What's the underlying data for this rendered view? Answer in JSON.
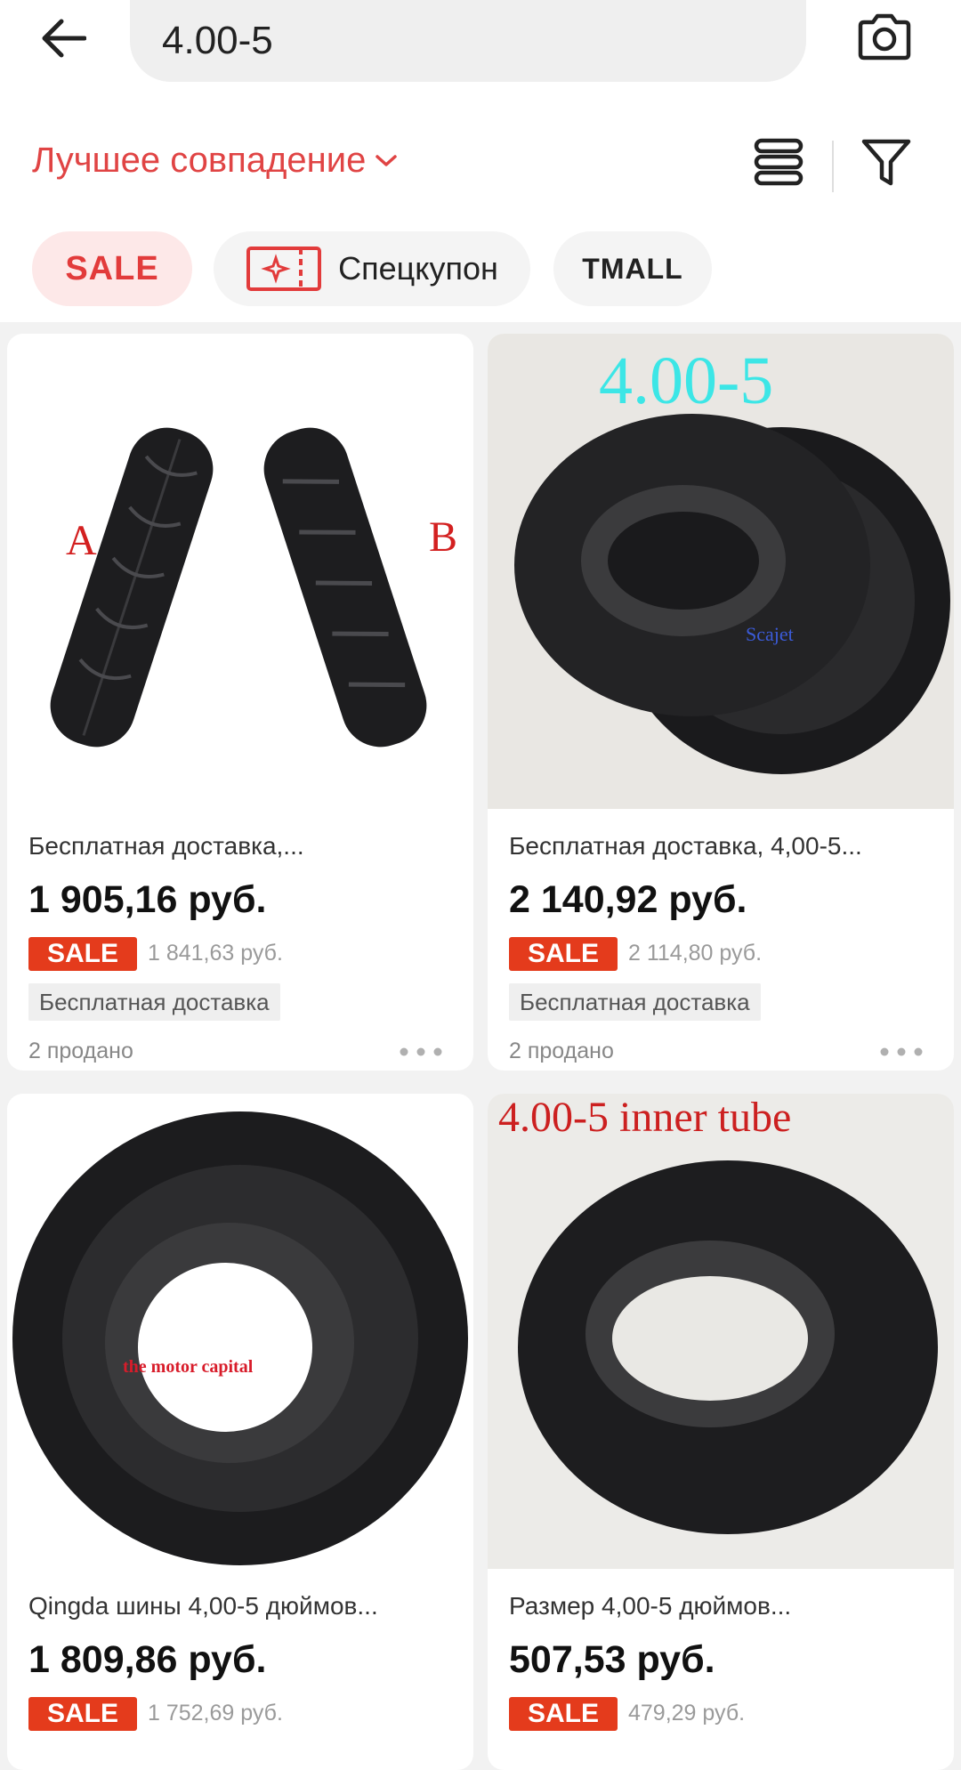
{
  "search": {
    "query": "4.00-5"
  },
  "sort": {
    "selected": "Лучшее совпадение"
  },
  "chips": [
    {
      "label": "SALE"
    },
    {
      "label": "Спецкупон"
    },
    {
      "label": "TMALL"
    }
  ],
  "products": [
    {
      "title": "Бесплатная доставка,...",
      "price": "1 905,16 руб.",
      "badge": "SALE",
      "old_price": "1 841,63 руб.",
      "shipping": "Бесплатная доставка",
      "sold": "2 продано",
      "image_labels": {
        "a": "A",
        "b": "B"
      }
    },
    {
      "title": "Бесплатная доставка, 4,00-5...",
      "price": "2 140,92 руб.",
      "badge": "SALE",
      "old_price": "2 114,80 руб.",
      "shipping": "Бесплатная доставка",
      "sold": "2 продано",
      "image_labels": {
        "top": "4.00-5",
        "mark": "Scajet"
      }
    },
    {
      "title": "Qingda шины 4,00-5 дюймов...",
      "price": "1 809,86 руб.",
      "badge": "SALE",
      "old_price": "1 752,69 руб.",
      "image_labels": {
        "mark": "the motor capital"
      }
    },
    {
      "title": "Размер 4,00-5 дюймов...",
      "price": "507,53 руб.",
      "badge": "SALE",
      "old_price": "479,29 руб.",
      "image_labels": {
        "top": "4.00-5 inner tube"
      }
    }
  ],
  "colors": {
    "accent": "#e04444",
    "sale_badge": "#e43b1c",
    "background": "#f2f2f2"
  },
  "icons": [
    "back-arrow-icon",
    "camera-icon",
    "chevron-down-icon",
    "list-layout-icon",
    "filter-icon",
    "coupon-icon",
    "more-dots-icon"
  ]
}
